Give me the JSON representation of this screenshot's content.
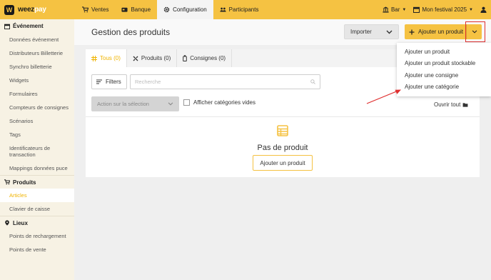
{
  "brand": {
    "logo_letter": "W",
    "name_part1": "weez",
    "name_part2": "pay"
  },
  "nav": [
    {
      "label": "Ventes",
      "icon": "cart-icon"
    },
    {
      "label": "Banque",
      "icon": "bank-card-icon"
    },
    {
      "label": "Configuration",
      "icon": "gear-icon",
      "active": true
    },
    {
      "label": "Participants",
      "icon": "people-icon"
    }
  ],
  "topright": {
    "venue": "Bar",
    "event": "Mon festival 2025"
  },
  "sidebar": {
    "group_event": "Événement",
    "event_items": [
      "Données événement",
      "Distributeurs Billetterie",
      "Synchro billetterie",
      "Widgets",
      "Formulaires",
      "Compteurs de consignes",
      "Scénarios",
      "Tags",
      "Identificateurs de transaction",
      "Mappings données puce"
    ],
    "group_products": "Produits",
    "product_items": [
      "Articles",
      "Clavier de caisse"
    ],
    "group_places": "Lieux",
    "place_items": [
      "Points de rechargement",
      "Points de vente"
    ]
  },
  "header": {
    "title": "Gestion des produits",
    "import_label": "Importer",
    "add_label": "Ajouter un produit"
  },
  "tabs": [
    {
      "label": "Tous (0)",
      "icon": "grid-icon",
      "active": true
    },
    {
      "label": "Produits (0)",
      "icon": "tools-icon"
    },
    {
      "label": "Consignes (0)",
      "icon": "bottle-icon"
    }
  ],
  "toolbar": {
    "filters_label": "Filters",
    "search_placeholder": "Recherche",
    "action_label": "Action sur la sélection",
    "show_empty_label": "Afficher catégories vides",
    "open_all_label": "Ouvrir tout"
  },
  "empty": {
    "title": "Pas de produit",
    "button_label": "Ajouter un produit"
  },
  "dropdown": [
    "Ajouter un produit",
    "Ajouter un produit stockable",
    "Ajouter une consigne",
    "Ajouter une catégorie"
  ],
  "colors": {
    "brand_yellow": "#f5c242",
    "annotation_red": "#e03030",
    "active_text": "#f0b400"
  }
}
